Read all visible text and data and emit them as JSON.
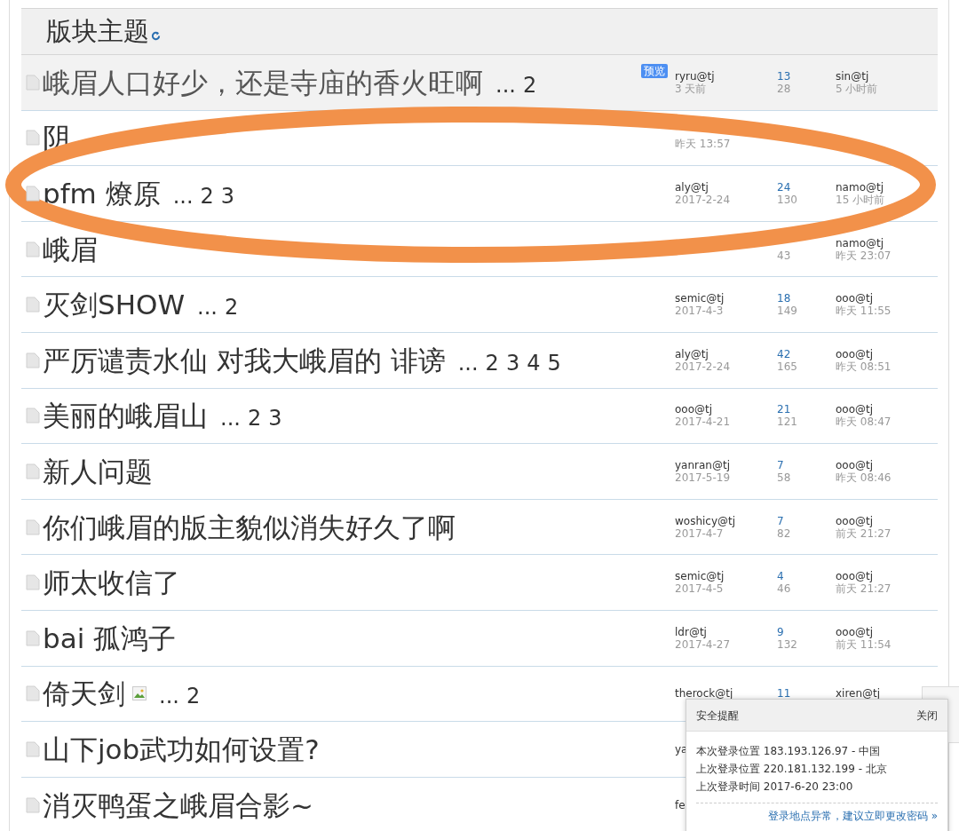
{
  "header": {
    "title": "版块主题"
  },
  "topics": [
    {
      "title": "峨眉人口好少，还是寺庙的香火旺啊",
      "pages": [
        "...",
        "2"
      ],
      "preview": "预览",
      "selected": true,
      "author": "ryru@tj",
      "date": "3 天前",
      "replies": "13",
      "views": "28",
      "last_user": "sin@tj",
      "last_time": "5 小时前"
    },
    {
      "title": "阴",
      "selected": false,
      "date": "昨天 13:57"
    },
    {
      "title": "pfm 燎原",
      "pages": [
        "...",
        "2",
        "3"
      ],
      "selected": false,
      "author": "aly@tj",
      "date": "2017-2-24",
      "replies": "24",
      "views": "130",
      "last_user": "namo@tj",
      "last_time": "15 小时前"
    },
    {
      "title": "峨眉",
      "selected": false,
      "views": "43",
      "last_user": "namo@tj",
      "last_time": "昨天 23:07"
    },
    {
      "title": "灭剑SHOW",
      "pages": [
        "...",
        "2"
      ],
      "selected": false,
      "author": "semic@tj",
      "date": "2017-4-3",
      "replies": "18",
      "views": "149",
      "last_user": "ooo@tj",
      "last_time": "昨天 11:55"
    },
    {
      "title": "严厉谴责水仙 对我大峨眉的 诽谤",
      "pages": [
        "...",
        "2",
        "3",
        "4",
        "5"
      ],
      "selected": false,
      "author": "aly@tj",
      "date": "2017-2-24",
      "replies": "42",
      "views": "165",
      "last_user": "ooo@tj",
      "last_time": "昨天 08:51"
    },
    {
      "title": "美丽的峨眉山",
      "pages": [
        "...",
        "2",
        "3"
      ],
      "selected": false,
      "author": "ooo@tj",
      "date": "2017-4-21",
      "replies": "21",
      "views": "121",
      "last_user": "ooo@tj",
      "last_time": "昨天 08:47"
    },
    {
      "title": "新人问题",
      "selected": false,
      "author": "yanran@tj",
      "date": "2017-5-19",
      "replies": "7",
      "views": "58",
      "last_user": "ooo@tj",
      "last_time": "昨天 08:46"
    },
    {
      "title": "你们峨眉的版主貌似消失好久了啊",
      "selected": false,
      "author": "woshicy@tj",
      "date": "2017-4-7",
      "replies": "7",
      "views": "82",
      "last_user": "ooo@tj",
      "last_time": "前天 21:27"
    },
    {
      "title": "师太收信了",
      "selected": false,
      "author": "semic@tj",
      "date": "2017-4-5",
      "replies": "4",
      "views": "46",
      "last_user": "ooo@tj",
      "last_time": "前天 21:27"
    },
    {
      "title": "bai 孤鸿子",
      "selected": false,
      "author": "ldr@tj",
      "date": "2017-4-27",
      "replies": "9",
      "views": "132",
      "last_user": "ooo@tj",
      "last_time": "前天 11:54"
    },
    {
      "title": "倚天剑",
      "image": true,
      "pages": [
        "...",
        "2"
      ],
      "selected": false,
      "author": "therock@tj",
      "replies": "11",
      "last_user": "xiren@tj"
    },
    {
      "title": "山下job武功如何设置?",
      "selected": false,
      "author": "ya"
    },
    {
      "title": "消灭鸭蛋之峨眉合影~",
      "selected": false,
      "author": "fe"
    }
  ],
  "security_popup": {
    "title": "安全提醒",
    "close": "关闭",
    "lines": [
      "本次登录位置 183.193.126.97 - 中国",
      "上次登录位置 220.181.132.199 - 北京",
      "上次登录时间 2017-6-20 23:00"
    ],
    "link": "登录地点异常，建议立即更改密码 »"
  }
}
